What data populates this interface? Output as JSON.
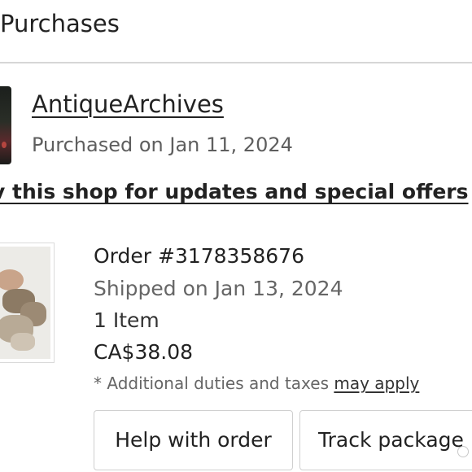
{
  "header": {
    "title": "Purchases"
  },
  "shop": {
    "name": "AntiqueArchives",
    "purchased": "Purchased on Jan 11, 2024",
    "follow_text": "v this shop for updates and special offers"
  },
  "order": {
    "number": "Order #3178358676",
    "shipped": "Shipped on Jan 13, 2024",
    "items": "1 Item",
    "price": "CA$38.08",
    "duties_prefix": "* Additional duties and taxes ",
    "duties_link": "may apply"
  },
  "actions": {
    "help": "Help with order",
    "track": "Track package"
  },
  "colors": {
    "text": "#222222",
    "muted": "#5e5e5e",
    "border": "#cfcfcf"
  }
}
